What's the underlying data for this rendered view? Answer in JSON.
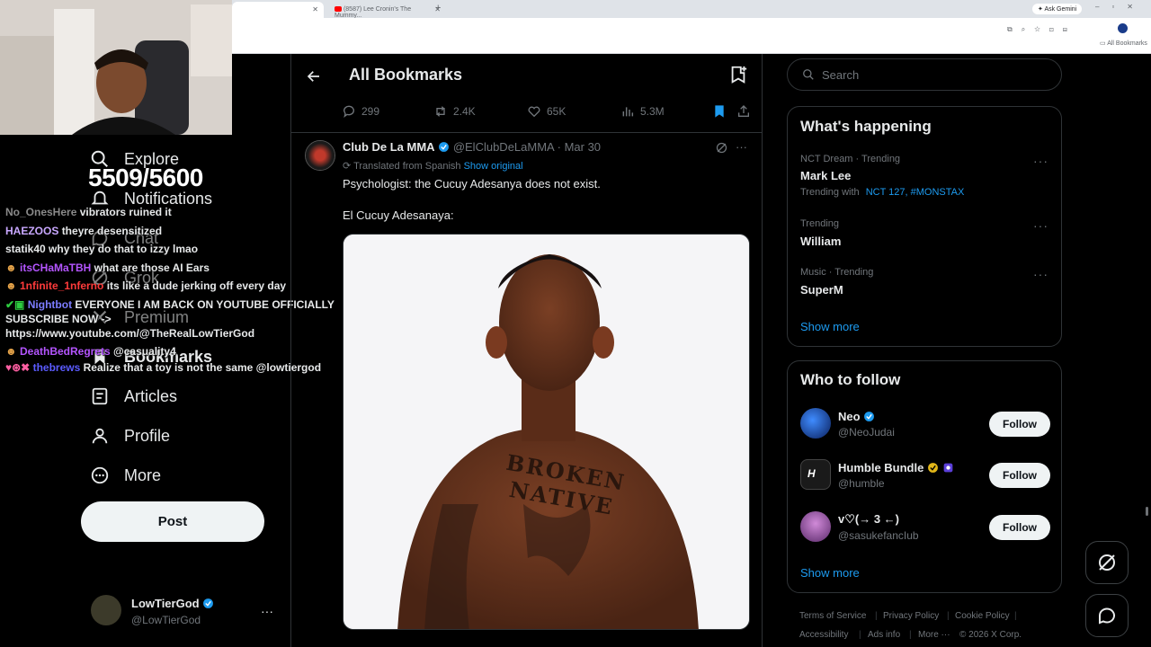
{
  "browser": {
    "tab1_title": "x",
    "tab2_title": "(8587) Lee Cronin's The Mummy...",
    "ask_gemini": "Ask Gemini",
    "bookmarks_bar_label": "All Bookmarks"
  },
  "stream": {
    "counter": "5509/5600",
    "chat": [
      {
        "user": "No_OnesHere",
        "msg": "vibrators ruined it",
        "color": "#8a8a8a"
      },
      {
        "user": "HAEZOOS",
        "msg": "theyre desensitized",
        "color": "#c9a8ff"
      },
      {
        "user": "statik40",
        "msg": "why they do that to izzy lmao",
        "color": "#e7e9ea"
      },
      {
        "user": "itsCHaMaTBH",
        "msg": "what are those AI Ears",
        "color": "#b455ff"
      },
      {
        "user": "1nfinite_1nferno",
        "msg": "its like a dude jerking off every day",
        "color": "#ff3b3b"
      },
      {
        "user": "Nightbot",
        "msg": "EVERYONE I AM BACK ON YOUTUBE OFFICIALLY SUBSCRIBE NOW -> https://www.youtube.com/@TheRealLowTierGod",
        "color": "#7c7cff"
      },
      {
        "user": "DeathBedRegrets",
        "msg": "@casuality4",
        "color": "#b455ff"
      },
      {
        "user": "thebrews",
        "msg": "Realize that a toy is not the same @lowtiergod",
        "color": "#5b5bff"
      }
    ]
  },
  "nav": {
    "explore": "Explore",
    "notifications": "Notifications",
    "chat": "Chat",
    "grok": "Grok",
    "premium": "Premium",
    "bookmarks": "Bookmarks",
    "articles": "Articles",
    "profile": "Profile",
    "more": "More",
    "post": "Post",
    "account_name": "LowTierGod",
    "account_handle": "@LowTierGod"
  },
  "main": {
    "title": "All Bookmarks",
    "prev_actions": {
      "replies": "299",
      "reposts": "2.4K",
      "likes": "65K",
      "views": "5.3M"
    },
    "tweet": {
      "author": "Club De La MMA",
      "handle": "@ElClubDeLaMMA",
      "date": "· Mar 30",
      "translated": "Translated from Spanish",
      "show_original": "Show original",
      "line1": "Psychologist: the Cucuy Adesanya does not exist.",
      "line2": "El Cucuy Adesanaya:",
      "tattoo": "BROKEN NATIVE"
    }
  },
  "right": {
    "search_placeholder": "Search",
    "happening_title": "What's happening",
    "trends": [
      {
        "meta": "NCT Dream · Trending",
        "name": "Mark Lee",
        "extra_prefix": "Trending with",
        "extra_links": "NCT 127, #MONSTAX"
      },
      {
        "meta": "Trending",
        "name": "William"
      },
      {
        "meta": "Music · Trending",
        "name": "SuperM"
      }
    ],
    "show_more": "Show more",
    "who_title": "Who to follow",
    "who": [
      {
        "name": "Neo",
        "handle": "@NeoJudai",
        "button": "Follow"
      },
      {
        "name": "Humble Bundle",
        "handle": "@humble",
        "button": "Follow"
      },
      {
        "name": "v♡(→ 3 ←)",
        "handle": "@sasukefancIub",
        "button": "Follow"
      }
    ],
    "footer": [
      "Terms of Service",
      "Privacy Policy",
      "Cookie Policy",
      "Accessibility",
      "Ads info",
      "More ···",
      "© 2026 X Corp."
    ]
  },
  "colors": {
    "accent": "#1d9bf0",
    "background": "#000000",
    "border": "#2f3336",
    "muted": "#71767b"
  }
}
